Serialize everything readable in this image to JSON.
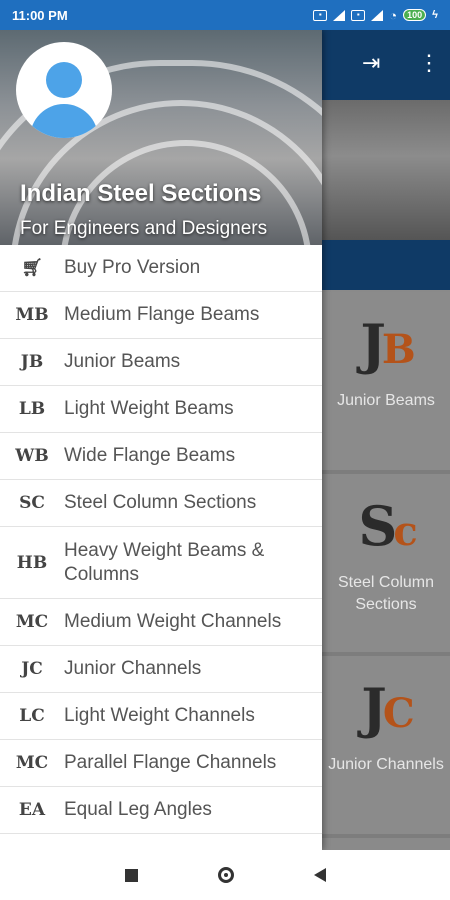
{
  "status_bar": {
    "time": "11:00 PM",
    "battery": "100",
    "icons": [
      "sim-icon",
      "signal-icon",
      "sim2-icon",
      "signal2-icon",
      "wifi-icon",
      "battery-icon",
      "charging-icon"
    ]
  },
  "drawer": {
    "title": "Indian Steel Sections",
    "subtitle": "For Engineers and Designers",
    "items": [
      {
        "icon": "cart-icon",
        "code": "",
        "label": "Buy Pro Version"
      },
      {
        "icon": "mb-icon",
        "code": "MB",
        "label": "Medium Flange Beams"
      },
      {
        "icon": "jb-icon",
        "code": "JB",
        "label": "Junior Beams"
      },
      {
        "icon": "lb-icon",
        "code": "LB",
        "label": "Light Weight Beams"
      },
      {
        "icon": "wb-icon",
        "code": "WB",
        "label": "Wide Flange Beams"
      },
      {
        "icon": "sc-icon",
        "code": "SC",
        "label": "Steel Column Sections"
      },
      {
        "icon": "hb-icon",
        "code": "HB",
        "label": "Heavy Weight Beams & Columns"
      },
      {
        "icon": "mc-icon",
        "code": "MC",
        "label": "Medium Weight Channels"
      },
      {
        "icon": "jc-icon",
        "code": "JC",
        "label": "Junior Channels"
      },
      {
        "icon": "lc-icon",
        "code": "LC",
        "label": "Light Weight Channels"
      },
      {
        "icon": "pc-icon",
        "code": "MC",
        "label": "Parallel Flange Channels"
      },
      {
        "icon": "ea-icon",
        "code": "EA",
        "label": "Equal Leg Angles"
      }
    ]
  },
  "background_tiles": [
    {
      "logo_a": "J",
      "logo_b": "B",
      "label": "Junior Beams"
    },
    {
      "logo_a": "S",
      "logo_b": "c",
      "label": "Steel Column Sections"
    },
    {
      "logo_a": "J",
      "logo_b": "C",
      "label": "Junior Channels"
    }
  ],
  "colors": {
    "toolbar": "#0f3a66",
    "status": "#1f6fbf",
    "accent": "#b4531a"
  }
}
